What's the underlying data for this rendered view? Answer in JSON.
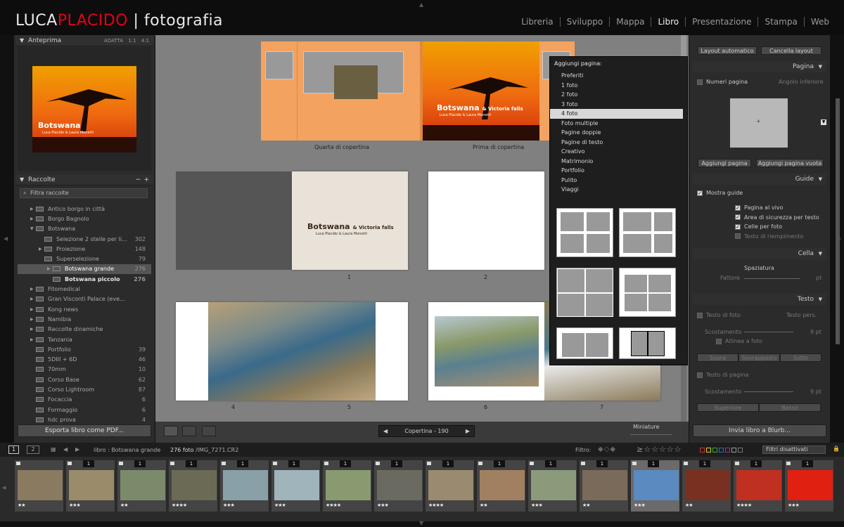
{
  "app": {
    "brand_first": "LUCA",
    "brand_second": "PLACIDO",
    "brand_sep": "|",
    "brand_sub": "fotografia",
    "modules": [
      "Libreria",
      "Sviluppo",
      "Mappa",
      "Libro",
      "Presentazione",
      "Stampa",
      "Web"
    ],
    "active_module": "Libro",
    "colors": {
      "accent_red": "#e0001b",
      "orange_cover": "#f4a260"
    }
  },
  "left": {
    "preview_title": "Anteprima",
    "preview_opts": "ADATTA 1:1 4:1",
    "preview_book_title": "Botswana",
    "preview_book_subtitle": "& Victoria falls",
    "preview_book_authors": "Luca Placido & Laura Monetti",
    "collections_title": "Raccolte",
    "collections_add": "+",
    "collections_remove": "−",
    "filter_placeholder": "Filtra raccolte",
    "collections": [
      {
        "label": "Antico borgo in città",
        "count": "",
        "indent": 1,
        "arrow": "▶"
      },
      {
        "label": "Borgo Bagnolo",
        "count": "",
        "indent": 1,
        "arrow": "▶"
      },
      {
        "label": "Botswana",
        "count": "",
        "indent": 1,
        "arrow": "▼"
      },
      {
        "label": "Selezione 2 stelle per li...",
        "count": "302",
        "indent": 2,
        "arrow": ""
      },
      {
        "label": "Proiezione",
        "count": "148",
        "indent": 2,
        "arrow": "▶"
      },
      {
        "label": "Superselezione",
        "count": "79",
        "indent": 2,
        "arrow": ""
      },
      {
        "label": "Botswana grande",
        "count": "276",
        "indent": 3,
        "arrow": "▶",
        "selected": true
      },
      {
        "label": "Botswana piccolo",
        "count": "276",
        "indent": 3,
        "arrow": "",
        "bold": true
      },
      {
        "label": "Fitomedical",
        "count": "",
        "indent": 1,
        "arrow": "▶"
      },
      {
        "label": "Gran Visconti Palace (eve...",
        "count": "",
        "indent": 1,
        "arrow": "▶"
      },
      {
        "label": "Kong news",
        "count": "",
        "indent": 1,
        "arrow": "▶"
      },
      {
        "label": "Namibia",
        "count": "",
        "indent": 1,
        "arrow": "▶"
      },
      {
        "label": "Raccolte dinamiche",
        "count": "",
        "indent": 1,
        "arrow": "▶"
      },
      {
        "label": "Tanzania",
        "count": "",
        "indent": 1,
        "arrow": "▶"
      },
      {
        "label": "Portfolio",
        "count": "39",
        "indent": 1,
        "arrow": ""
      },
      {
        "label": "5DIII + 6D",
        "count": "46",
        "indent": 1,
        "arrow": ""
      },
      {
        "label": "70mm",
        "count": "10",
        "indent": 1,
        "arrow": ""
      },
      {
        "label": "Corso Base",
        "count": "62",
        "indent": 1,
        "arrow": ""
      },
      {
        "label": "Corso Lightroom",
        "count": "87",
        "indent": 1,
        "arrow": ""
      },
      {
        "label": "Focaccia",
        "count": "6",
        "indent": 1,
        "arrow": ""
      },
      {
        "label": "Formaggio",
        "count": "6",
        "indent": 1,
        "arrow": ""
      },
      {
        "label": "hdc prova",
        "count": "4",
        "indent": 1,
        "arrow": ""
      }
    ],
    "export_button": "Esporta libro come PDF..."
  },
  "center": {
    "back_cover_label": "Quarta di copertina",
    "front_cover_label": "Prima di copertina",
    "spine_text": "Botswana & Victoria falls",
    "cover_title": "Botswana",
    "cover_subtitle": "& Victoria falls",
    "cover_authors": "Luca Placido & Laura Monetti",
    "page_numbers": [
      "1",
      "2",
      "4",
      "5",
      "6",
      "7"
    ],
    "pager_label": "Copertina - 190",
    "thumbnails_label": "Miniature"
  },
  "popup": {
    "title": "Aggiungi pagina:",
    "items": [
      "Preferiti",
      "1 foto",
      "2 foto",
      "3 foto",
      "4 foto",
      "Foto multiple",
      "Pagine doppie",
      "Pagine di testo",
      "Creativo",
      "Matrimonio",
      "Portfolio",
      "Pulito",
      "Viaggi"
    ],
    "selected": "4 foto"
  },
  "right": {
    "auto_layout": "Layout automatico",
    "clear_layout": "Cancella layout",
    "page_section": "Pagina",
    "page_numbers_label": "Numeri pagina",
    "page_numbers_pos": "Angolo inferiore",
    "add_page": "Aggiungi pagina",
    "add_blank_page": "Aggiungi pagina vuota",
    "guides_section": "Guide",
    "show_guides": "Mostra guide",
    "guides": [
      {
        "label": "Pagina al vivo",
        "checked": true
      },
      {
        "label": "Area di sicurezza per testo",
        "checked": true
      },
      {
        "label": "Celle per foto",
        "checked": true
      },
      {
        "label": "Testo di riempimento",
        "checked": false
      }
    ],
    "cell_section": "Cella",
    "spacing_label": "Spaziatura",
    "factor_label": "Fattore",
    "factor_unit": "pt",
    "text_section": "Testo",
    "photo_text_label": "Testo di foto",
    "photo_text_mode": "Testo pers.",
    "offset_label": "Scostamento",
    "offset_value": "9 pt",
    "align_photo": "Allinea a foto",
    "pos_buttons": [
      "Sopra",
      "Sovrapposto",
      "Sotto"
    ],
    "page_text_label": "Testo di pagina",
    "offset_value2": "9 pt",
    "pos_buttons2": [
      "Superiore",
      "Basso"
    ],
    "send_button": "Invia libro a Blurb..."
  },
  "filmstrip": {
    "screen1": "1",
    "screen2": "2",
    "path_prefix": "libro : Botswana grande",
    "count_label": "276 foto",
    "file_label": "/IMG_7271.CR2",
    "filter_label": "Filtro:",
    "filter_state": "Filtri disattivati",
    "thumbs": [
      {
        "num": "",
        "stars": "★★",
        "color": "#8a7a60"
      },
      {
        "num": "1",
        "stars": "★★★",
        "color": "#9a8c6a"
      },
      {
        "num": "1",
        "stars": "★★",
        "color": "#7a8a6a"
      },
      {
        "num": "1",
        "stars": "★★★★",
        "color": "#6a6a55"
      },
      {
        "num": "1",
        "stars": "★★★",
        "color": "#8aa0a8"
      },
      {
        "num": "1",
        "stars": "★★★",
        "color": "#a0b4bc"
      },
      {
        "num": "1",
        "stars": "★★★★",
        "color": "#8a9a70"
      },
      {
        "num": "1",
        "stars": "★★★",
        "color": "#6a6a60"
      },
      {
        "num": "1",
        "stars": "★★★★",
        "color": "#9a8a70"
      },
      {
        "num": "1",
        "stars": "★★",
        "color": "#a08060"
      },
      {
        "num": "1",
        "stars": "★★★",
        "color": "#8a9a7a"
      },
      {
        "num": "1",
        "stars": "★★",
        "color": "#7a6a5a"
      },
      {
        "num": "1",
        "stars": "★★★",
        "color": "#5a8ac0"
      },
      {
        "num": "1",
        "stars": "★★",
        "color": "#7a3020"
      },
      {
        "num": "1",
        "stars": "★★★★",
        "color": "#c03020"
      },
      {
        "num": "1",
        "stars": "★★★",
        "color": "#e02010"
      }
    ]
  }
}
